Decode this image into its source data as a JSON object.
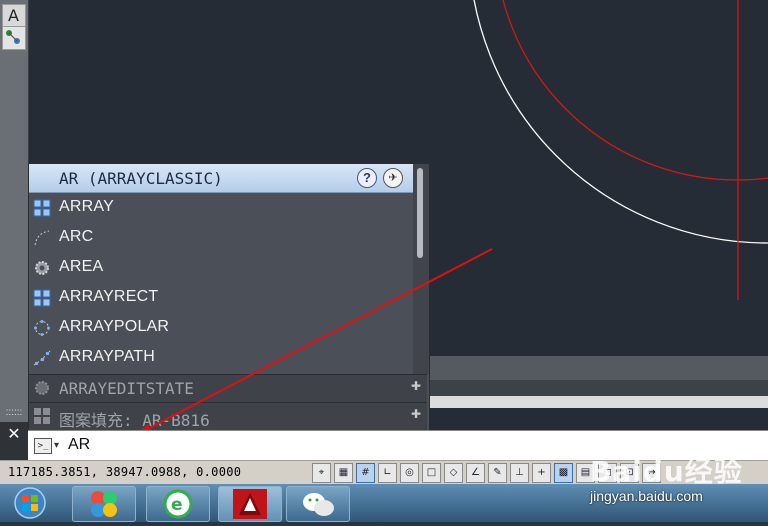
{
  "left_toolbar": {
    "text_tool_glyph": "A"
  },
  "autocomplete": {
    "header": "AR (ARRAYCLASSIC)",
    "items": [
      {
        "label": "ARRAY",
        "icon": "array-grid-icon"
      },
      {
        "label": "ARC",
        "icon": "arc-icon"
      },
      {
        "label": "AREA",
        "icon": "gear-icon"
      },
      {
        "label": "ARRAYRECT",
        "icon": "array-grid-icon"
      },
      {
        "label": "ARRAYPOLAR",
        "icon": "polar-array-icon"
      },
      {
        "label": "ARRAYPATH",
        "icon": "path-array-icon"
      }
    ],
    "dim_items": [
      {
        "label": "ARRAYEDITSTATE",
        "icon": "gear-icon"
      },
      {
        "label": "图案填充: AR-B816",
        "icon": "hatch-icon"
      }
    ],
    "help_glyph": "?",
    "web_glyph": "✈"
  },
  "command_line": {
    "value": "AR",
    "prompt_glyph": ">_",
    "dropdown_glyph": "▾",
    "close_glyph": "✕"
  },
  "status_bar": {
    "coordinates": "117185.3851, 38947.0988, 0.0000",
    "buttons": [
      "⌖",
      "▦",
      "#",
      "∟",
      "◎",
      "□",
      "◇",
      "∠",
      "✎",
      "⊥",
      "+",
      "▩",
      "▤",
      "◻",
      "⊡",
      "↔"
    ]
  },
  "watermark": {
    "brand": "Baidu经验",
    "url": "jingyan.baidu.com"
  },
  "colors": {
    "canvas_bg": "#262c36",
    "red_circle": "#d01818",
    "white_circle": "#ffffff",
    "arrow": "#e01010",
    "autocomplete_header": "#c6d9ef"
  }
}
